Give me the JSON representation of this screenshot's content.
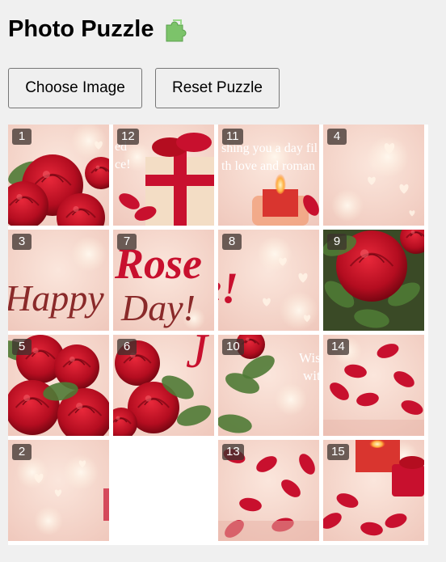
{
  "app": {
    "title": "Photo Puzzle",
    "title_icon": "puzzle-piece-icon"
  },
  "toolbar": {
    "choose_label": "Choose Image",
    "reset_label": "Reset Puzzle"
  },
  "board": {
    "grid_size": 4,
    "empty_cell": 13,
    "cells": [
      "1",
      "12",
      "11",
      "4",
      "3",
      "7",
      "8",
      "9",
      "5",
      "6",
      "10",
      "14",
      "2",
      "",
      "13",
      "15"
    ]
  },
  "image_text": {
    "line1": "Happy",
    "line2": "Rose",
    "line3": "Day!",
    "wish1": "Wishing you a day filled",
    "wish2": "with love and romance!"
  },
  "colors": {
    "accent_red": "#c8102e",
    "background": "#f0f0f0",
    "badge": "#3c322d"
  }
}
